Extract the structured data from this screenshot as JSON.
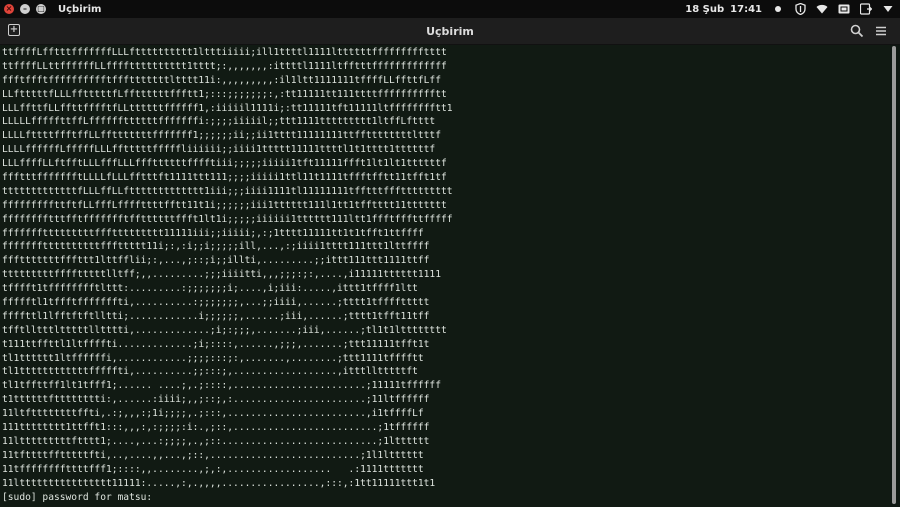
{
  "topbar": {
    "app_name": "Uçbirim",
    "date": "18 Şub",
    "time": "17:41",
    "icons": [
      "close-icon",
      "minimize-icon",
      "maximize-icon",
      "notification-dot-icon",
      "shield-icon",
      "wifi-icon",
      "battery-icon",
      "power-icon",
      "chevron-down-icon"
    ]
  },
  "window": {
    "title": "Uçbirim",
    "icons": [
      "new-tab-icon",
      "search-icon",
      "menu-icon"
    ]
  },
  "colors": {
    "background": "#111a13",
    "text": "#dfe5df",
    "close": "#e0443a"
  },
  "terminal": {
    "lines": [
      "ttffffLfftttfffffffLLLftttttttttt1ltttiiiii;ill1ttttl1111lttttttffffffffftttt",
      "ttffffLLttffffffLLfffftttttttttt1tttt;:,,,,,,,:ittttl1111ltfftttfffffffffffff",
      "ffftffftfffffffffftffftttttttltttt11i:,,,,,,,,,:il1ltt1111111tffffLLffttfLff",
      "LLftttttfLLLfftttttfLffttttttffftt1;:::;;;;;;;:,:tt11111tt111ttttfffffffffftt",
      "LLLffttfLLffttfffftfLLttttttffffff1,:iiiiil1111i;:tt11111tft11111ltfffffffftt1",
      "LLLLLfffffttffLffffffttttttfffffffi:;;;;iiiiil;;ttt1111ttttttttt1ltffLftttt",
      "LLLLfttttffftffLLfftttttttfffffff1;;;;;;ii;;ii1tttt11111111ttffttttttttltttf",
      "LLLLffffffLfffffLLLfftttttfffffliiiiii;;iiii1ttttt11111ttttl1t1tttt1ttttttf",
      "LLLffffLLftfftLLLfffLLLfffttttttfffftiii;;;;;iiiii1tft11111ffft1lt1lt1ttttttf",
      "ffftttffffffftLLLLfLLLfftttft1111ttt111;;;;iiiii1ttl11t1111tffftfftt11tfft1tf",
      "tttttttttttttfLLLffLLfttttttttttttt1iii;;;iiii1111tl11111111tfftttfffttttttttt",
      "fffffffffttftfLLfffLffffttttfftt11t1i;;;;;;iii1tttttt111l1tt1tfftttt11ttttttt",
      "fffffffftttfftffffffftffttttttffft1lt1i;;;;;iiiiii1tttttt111ltt1ffftfffttfffff",
      "ffffffftttttttttfffttttttttt11111iii;;iiiii;,:;1tttt11111tt1t1tfft1ttffff",
      "fffffffttttttttttfffttttt11i;:,:i;;i;;;;;ill,...,:;iiii1tttt111ttt1lttffff",
      "ffftttttttfffttt1lttfflii;:,...,;::;i;;illti,.........;;ittt111ttt1111ttff",
      "tttttttttfffftttttlltff;,,.........;;;iiiitti,,,;;;:;:,....,i11111tttttt1111",
      "tfffft1tfffffffftlttt:.........:;;;;;;;i;....,i;iii:.....,ittt1tffff1ltt",
      "ffffftl1tffftfffffffti,..........:;;;;;;;,...;;iiii,......;tttt1tffffttttt",
      "ffffttl1lfftftftlltti;............i;;;;;;,......;iii,......;tttt1tfft11tff",
      "tfftlltttltttttlltttti,.............;i;:;;;,.......;iii,......;tl1t1ltttttttt",
      "t111ttffttl1ltffffti.............;i;::::,......,;;;,.......;ttt11111tfft1t",
      "tl1tttttt1ltffffffi,............;;;;:::;:,.......,........;ttt1111tfffftt",
      "tl1ttttttttttttfffffti,..........;;:::;,..................,itttlltttttft",
      "tl1tffttff1lt1tfff1;...... ....;,.;::::,.......................;11111tffffff",
      "t1ttttttftttttttti:,......:iiii;,,;::;,:.......................;11ltffffff",
      "11ltfttttttttffti,.:;,,,:;1i;;;;,.;:::,........................,i1tffffLf",
      "111tttttttt1ttfft1:::,,,:,:;;;;:i:.,;::,.........................;1tffffff",
      "11ltttttttttftttt1;....,...:;;;;,.,;::...........................;1ltttttt",
      "11tfttttfftttttfti,..,....,,...,;::,..........................;1l1ltttttt",
      "11tffffffffttttfff1;::::,,........,;,:,..................   .:1111ttttttt",
      "11ltttttttttttttttt11111:.....,:,.,,,,.................,:::,:1tt11111ttt1t1",
      "[sudo] password for matsu:"
    ]
  }
}
